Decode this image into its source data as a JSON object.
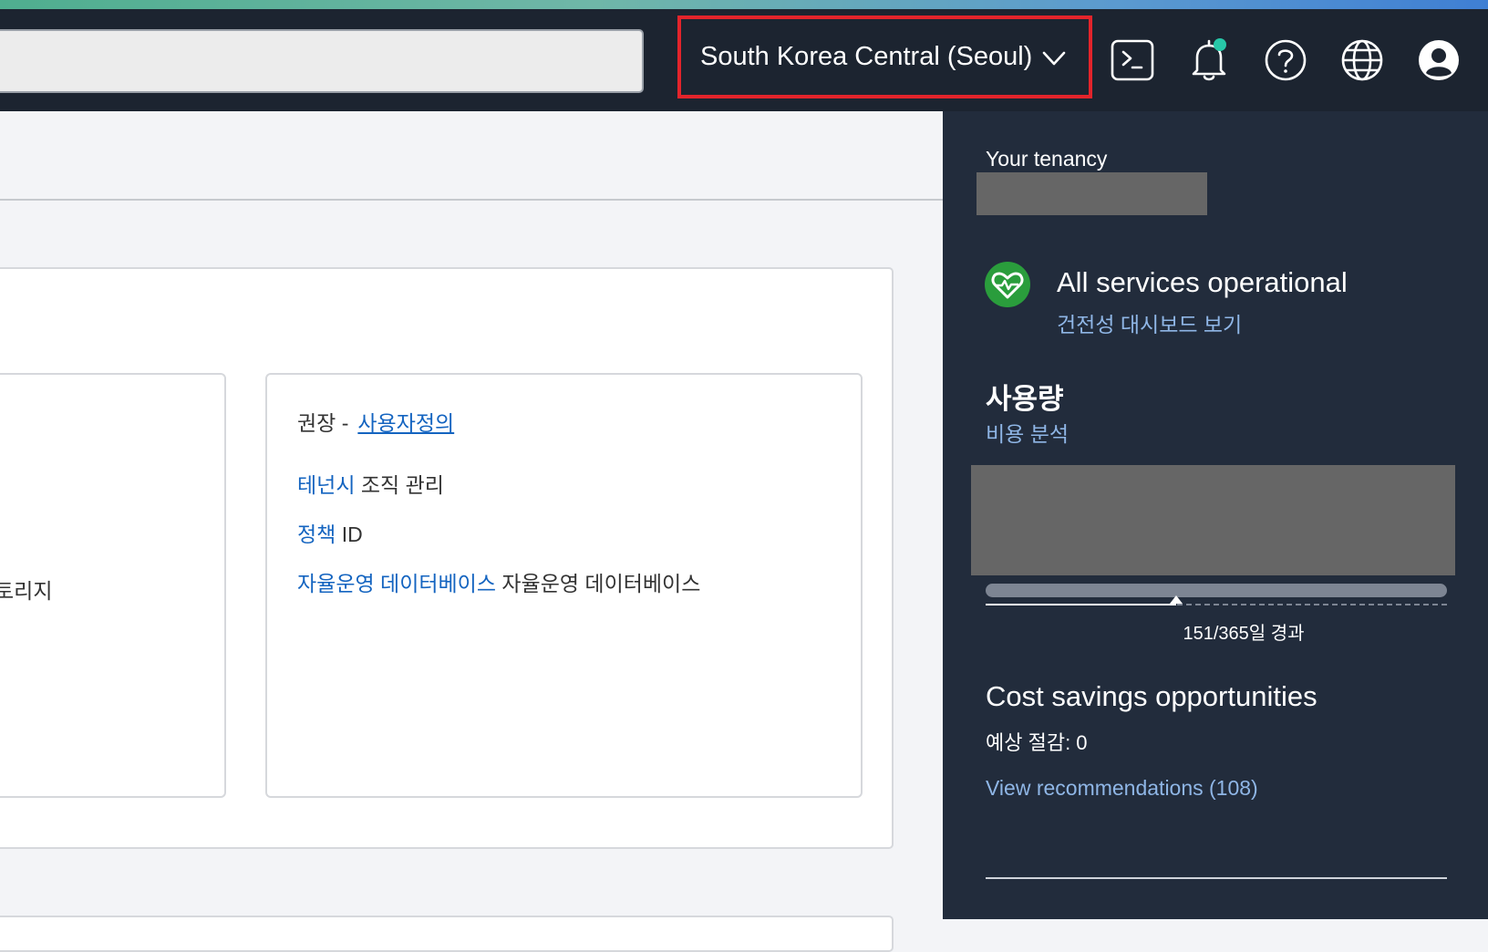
{
  "topbar": {
    "region_label": "South Korea Central (Seoul)",
    "icons": [
      "cloud-shell-icon",
      "bell-icon",
      "help-icon",
      "globe-icon",
      "profile-icon"
    ],
    "notification_dot_color": "#27c7a8"
  },
  "main": {
    "left_card_fragment": "토리지",
    "recommend": {
      "prefix": "권장 -",
      "link": "사용자정의"
    },
    "links": [
      {
        "link": "테넌시",
        "text": "조직 관리"
      },
      {
        "link": "정책",
        "text": "ID"
      },
      {
        "link": "자율운영 데이터베이스",
        "text": "자율운영 데이터베이스"
      }
    ]
  },
  "side": {
    "tenancy_label": "Your tenancy",
    "health_status": "All services operational",
    "health_link": "건전성 대시보드 보기",
    "usage_title": "사용량",
    "usage_link": "비용 분석",
    "days_elapsed": 151,
    "days_total": 365,
    "days_label": "151/365일 경과",
    "cost_title": "Cost savings opportunities",
    "cost_estimate": "예상 절감: 0",
    "cost_link": "View recommendations (108)"
  },
  "colors": {
    "topbar_bg": "#1c2430",
    "side_bg": "#222c3c",
    "region_highlight": "#e3242b",
    "link_blue": "#1464c0",
    "side_link": "#8fb6e6",
    "health_green": "#2a9d3c"
  }
}
